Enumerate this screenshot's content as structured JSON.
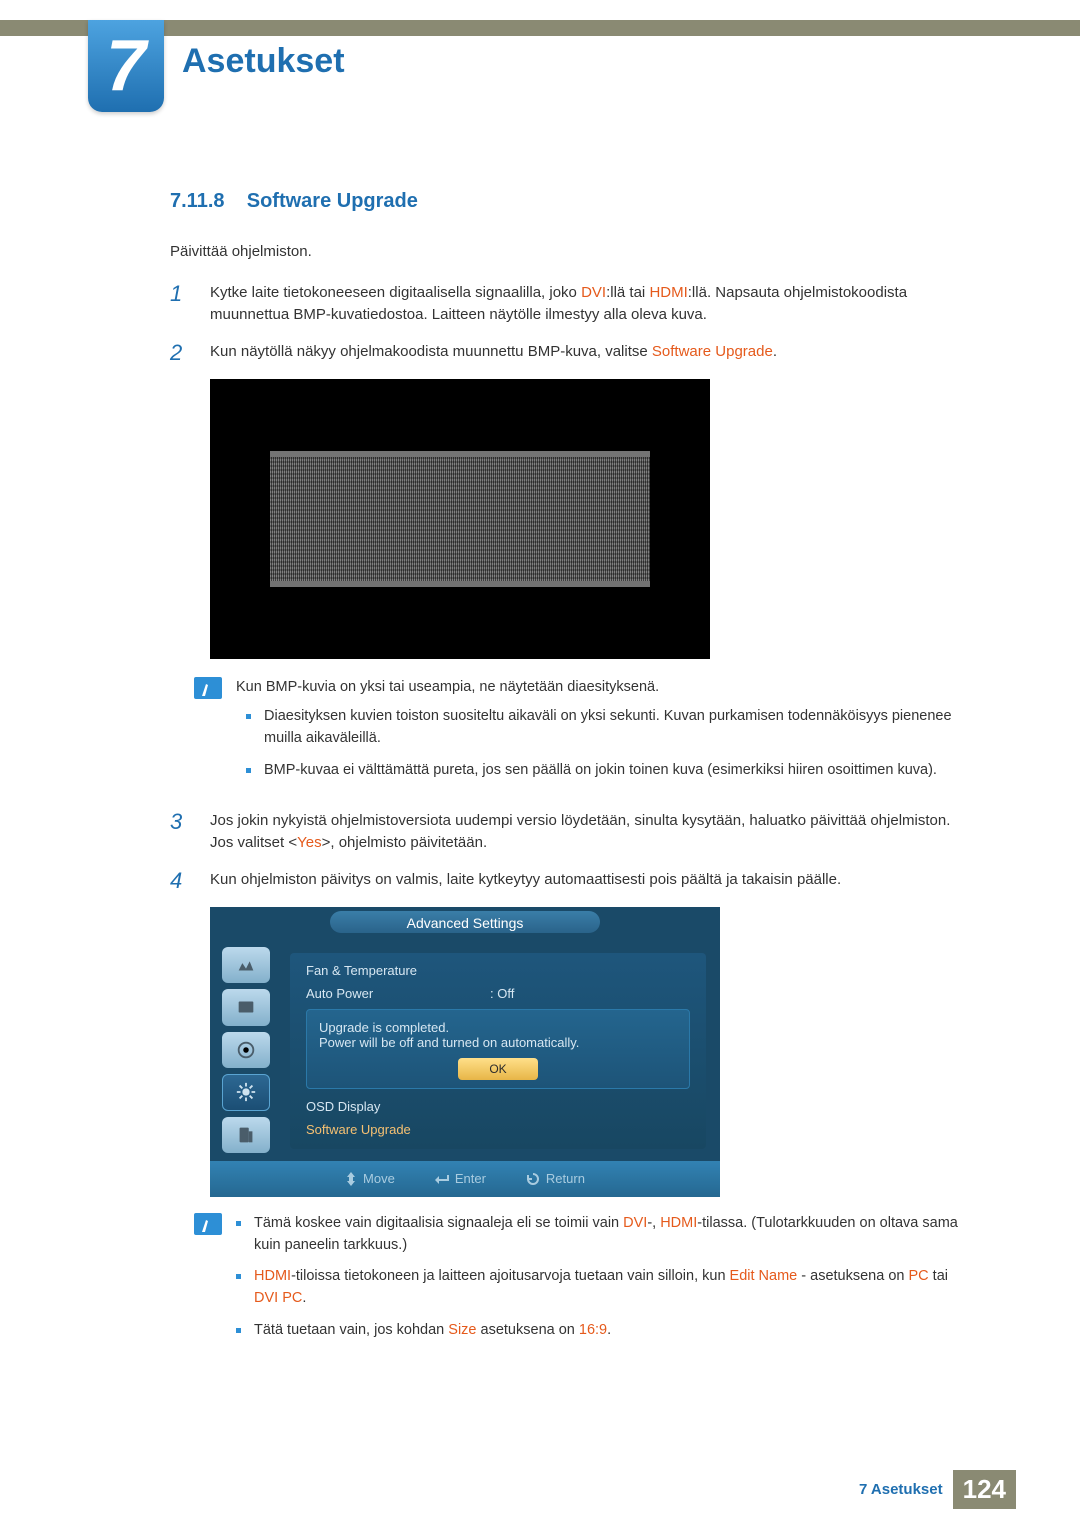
{
  "chapter": {
    "number": "7",
    "title": "Asetukset"
  },
  "section": {
    "number": "7.11.8",
    "title": "Software Upgrade"
  },
  "intro": "Päivittää ohjelmiston.",
  "steps": {
    "s1_a": "Kytke laite tietokoneeseen digitaalisella signaalilla, joko ",
    "dvi": "DVI",
    "s1_b": ":llä tai ",
    "hdmi": "HDMI",
    "s1_c": ":llä. Napsauta ohjelmistokoodista muunnettua BMP-kuvatiedostoa. Laitteen näytölle ilmestyy alla oleva kuva.",
    "s2_a": "Kun näytöllä näkyy ohjelmakoodista muunnettu BMP-kuva, valitse ",
    "s2_hl": "Software Upgrade",
    "s2_b": ".",
    "s3_a": "Jos jokin nykyistä ohjelmistoversiota uudempi versio löydetään, sinulta kysytään, haluatko päivittää ohjelmiston. Jos valitset <",
    "s3_hl": "Yes",
    "s3_b": ">, ohjelmisto päivitetään.",
    "s4": "Kun ohjelmiston päivitys on valmis, laite kytkeytyy automaattisesti pois päältä ja takaisin päälle."
  },
  "note1": {
    "lead": "Kun BMP-kuvia on yksi tai useampia, ne näytetään diaesityksenä.",
    "b1": "Diaesityksen kuvien toiston suositeltu aikaväli on yksi sekunti. Kuvan purkamisen todennäköisyys pienenee muilla aikaväleillä.",
    "b2": "BMP-kuvaa ei välttämättä pureta, jos sen päällä on jokin toinen kuva (esimerkiksi hiiren osoittimen kuva)."
  },
  "osd": {
    "title": "Advanced Settings",
    "fan": "Fan & Temperature",
    "auto_power": "Auto Power",
    "auto_power_val": ": Off",
    "dlg_l1": "Upgrade is completed.",
    "dlg_l2": "Power will be off and turned on automatically.",
    "ok": "OK",
    "osd_display": "OSD Display",
    "software_upgrade": "Software Upgrade",
    "move": "Move",
    "enter": "Enter",
    "return": "Return"
  },
  "note2": {
    "b1_a": "Tämä koskee vain digitaalisia signaaleja eli se toimii vain ",
    "b1_dvi": "DVI",
    "b1_mid": "-, ",
    "b1_hdmi": "HDMI",
    "b1_b": "-tilassa. (Tulotarkkuuden on oltava sama kuin paneelin tarkkuus.)",
    "b2_hdmi": "HDMI",
    "b2_a": "-tiloissa tietokoneen ja laitteen ajoitusarvoja tuetaan vain silloin, kun ",
    "b2_edit": "Edit Name",
    "b2_b": " - asetuksena on ",
    "b2_pc": "PC",
    "b2_or": " tai ",
    "b2_dvipc": "DVI PC",
    "b2_end": ".",
    "b3_a": "Tätä tuetaan vain, jos kohdan ",
    "b3_size": "Size",
    "b3_b": " asetuksena on ",
    "b3_169": "16:9",
    "b3_end": "."
  },
  "footer": {
    "crumb": "7 Asetukset",
    "page": "124"
  }
}
